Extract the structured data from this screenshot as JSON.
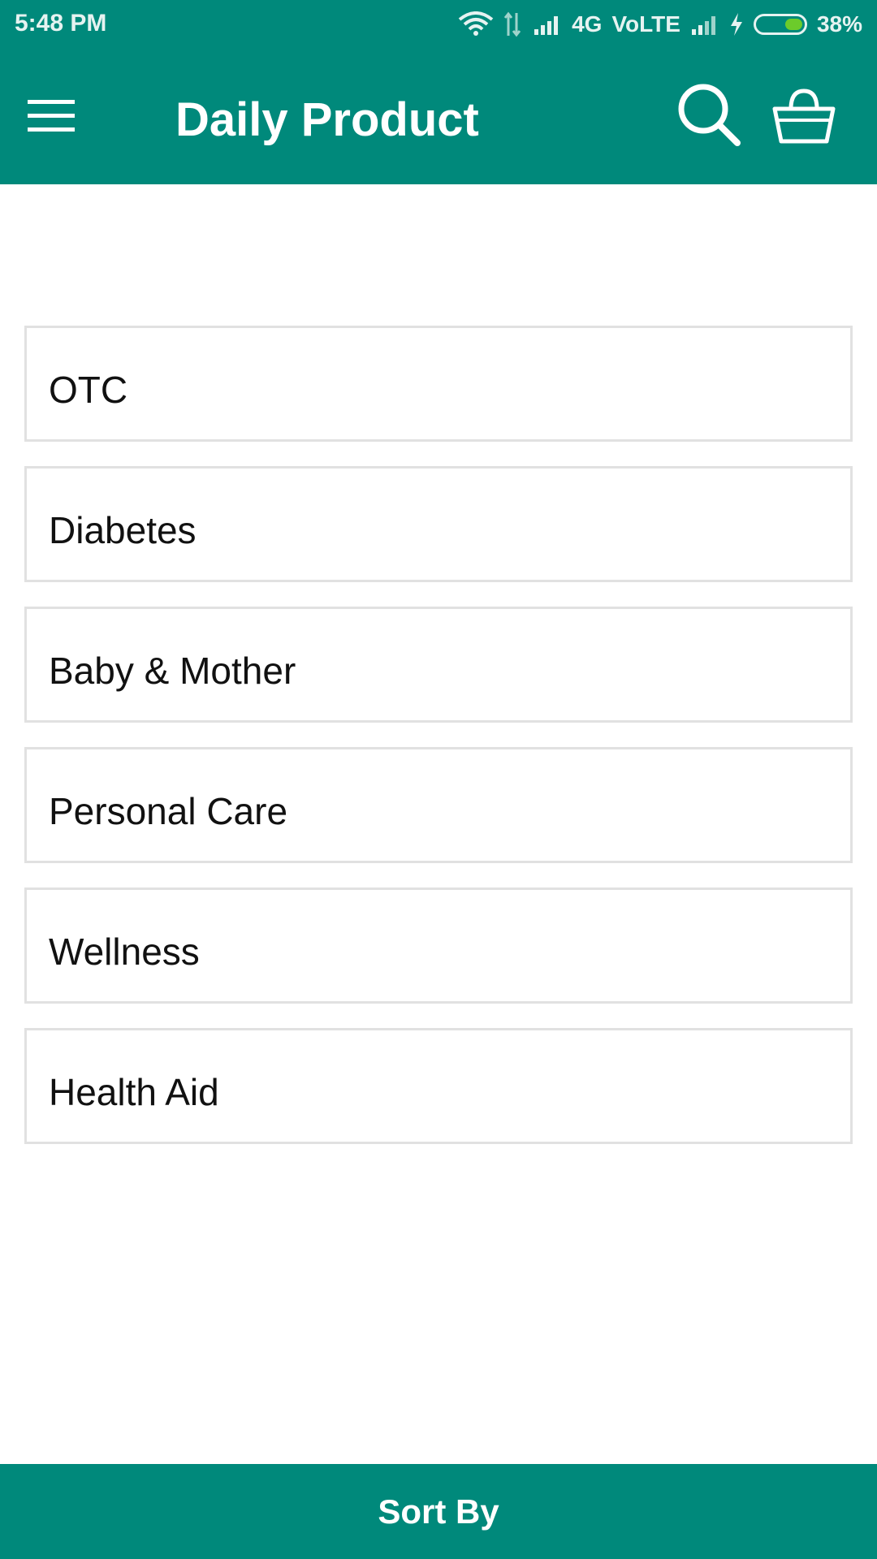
{
  "status_bar": {
    "time": "5:48 PM",
    "network": "4G",
    "volte": "VoLTE",
    "battery_percent": "38%",
    "battery_level": 0.38,
    "icons": [
      "wifi-icon",
      "data-arrows-icon",
      "signal-icon",
      "signal-icon",
      "charging-icon",
      "battery-icon"
    ]
  },
  "app_bar": {
    "title": "Daily Product",
    "icons": [
      "menu-icon",
      "search-icon",
      "basket-icon"
    ],
    "color": "#00897B"
  },
  "categories": [
    {
      "label": "OTC"
    },
    {
      "label": "Diabetes"
    },
    {
      "label": "Baby & Mother"
    },
    {
      "label": "Personal Care"
    },
    {
      "label": "Wellness"
    },
    {
      "label": "Health Aid"
    }
  ],
  "bottom_bar": {
    "label": "Sort By"
  },
  "colors": {
    "primary": "#00897B",
    "card_border": "#e1e1e1",
    "battery_fill": "#6CCB2B"
  }
}
